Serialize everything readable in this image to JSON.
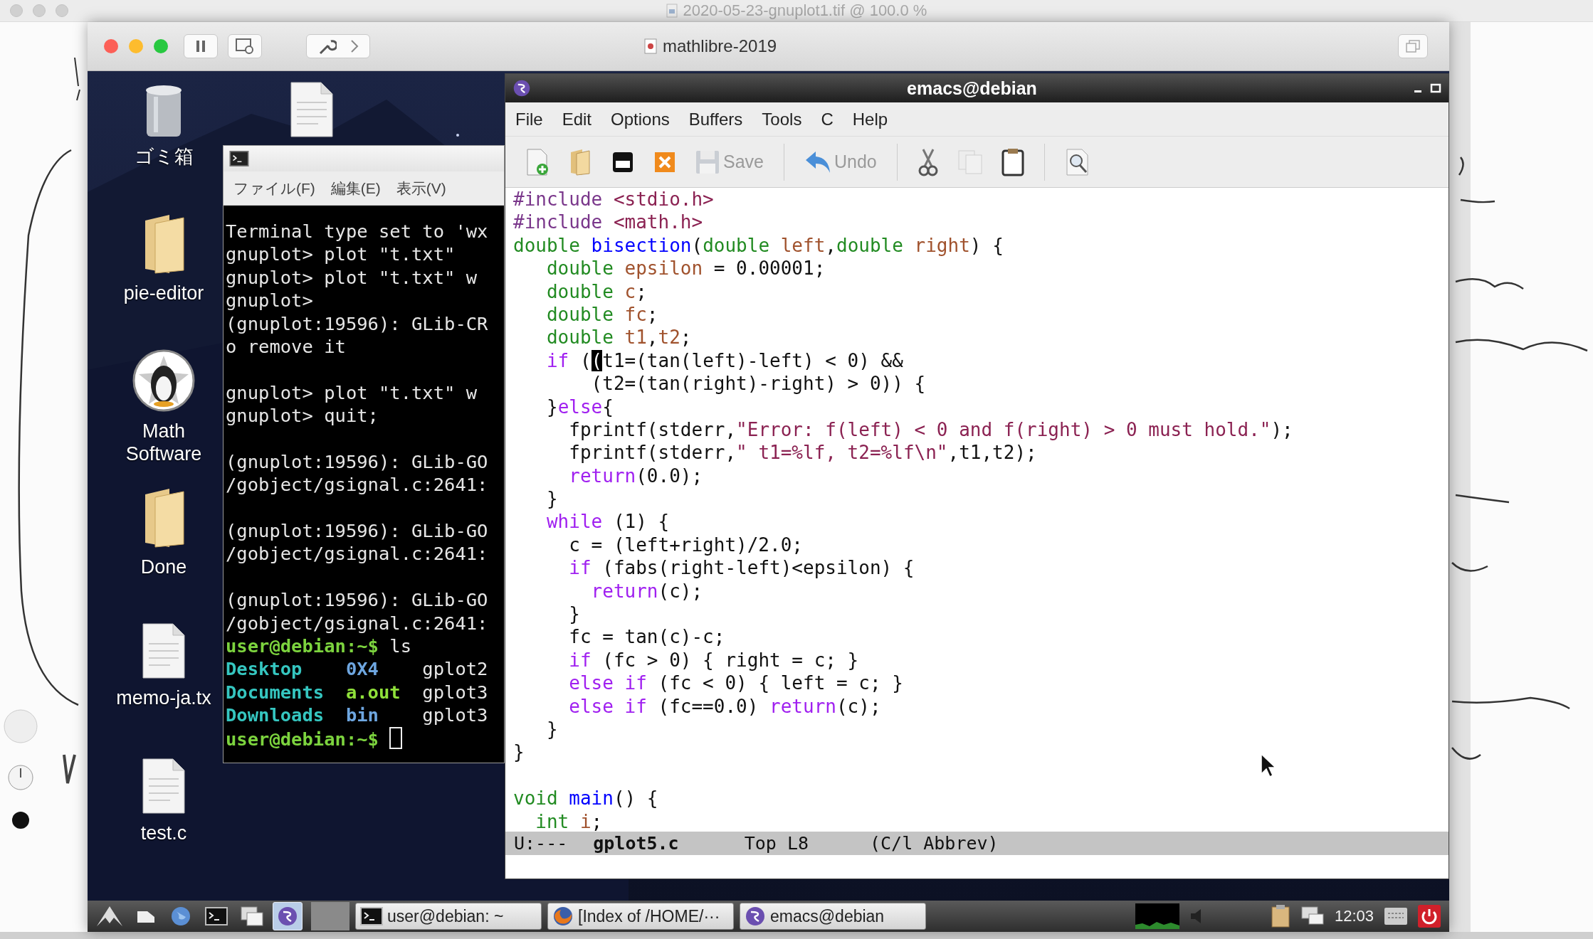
{
  "viewer": {
    "title": "2020-05-23-gnuplot1.tif @ 100.0 %"
  },
  "vm_window": {
    "title": "mathlibre-2019"
  },
  "desktop": {
    "icons": [
      {
        "kind": "trash",
        "label": "ゴミ箱"
      },
      {
        "kind": "file"
      },
      {
        "kind": "folder",
        "label": "pie-editor"
      },
      {
        "kind": "app",
        "label": "Math Software"
      },
      {
        "kind": "folder",
        "label": "Done"
      },
      {
        "kind": "file",
        "label": "memo-ja.tx"
      },
      {
        "kind": "file",
        "label": "test.c"
      }
    ]
  },
  "terminal": {
    "menu": [
      "ファイル(F)",
      "編集(E)",
      "表示(V)"
    ],
    "lines": [
      {
        "kind": "text",
        "spans": [
          {
            "kind": "plain",
            "text": "Terminal type set to 'wx"
          }
        ]
      },
      {
        "kind": "text",
        "spans": [
          {
            "kind": "plain",
            "text": "gnuplot> plot \"t.txt\""
          }
        ]
      },
      {
        "kind": "text",
        "spans": [
          {
            "kind": "plain",
            "text": "gnuplot> plot \"t.txt\" w"
          }
        ]
      },
      {
        "kind": "text",
        "spans": [
          {
            "kind": "plain",
            "text": "gnuplot>"
          }
        ]
      },
      {
        "kind": "text",
        "spans": [
          {
            "kind": "plain",
            "text": "(gnuplot:19596): GLib-CR"
          }
        ]
      },
      {
        "kind": "text",
        "spans": [
          {
            "kind": "plain",
            "text": "o remove it"
          }
        ]
      },
      {
        "kind": "blank"
      },
      {
        "kind": "text",
        "spans": [
          {
            "kind": "plain",
            "text": "gnuplot> plot \"t.txt\" w"
          }
        ]
      },
      {
        "kind": "text",
        "spans": [
          {
            "kind": "plain",
            "text": "gnuplot> quit;"
          }
        ]
      },
      {
        "kind": "blank"
      },
      {
        "kind": "text",
        "spans": [
          {
            "kind": "plain",
            "text": "(gnuplot:19596): GLib-GO"
          }
        ]
      },
      {
        "kind": "text",
        "spans": [
          {
            "kind": "plain",
            "text": "/gobject/gsignal.c:2641:"
          }
        ]
      },
      {
        "kind": "blank"
      },
      {
        "kind": "text",
        "spans": [
          {
            "kind": "plain",
            "text": "(gnuplot:19596): GLib-GO"
          }
        ]
      },
      {
        "kind": "text",
        "spans": [
          {
            "kind": "plain",
            "text": "/gobject/gsignal.c:2641:"
          }
        ]
      },
      {
        "kind": "blank"
      },
      {
        "kind": "text",
        "spans": [
          {
            "kind": "plain",
            "text": "(gnuplot:19596): GLib-GO"
          }
        ]
      },
      {
        "kind": "text",
        "spans": [
          {
            "kind": "plain",
            "text": "/gobject/gsignal.c:2641:"
          }
        ]
      },
      {
        "kind": "text",
        "spans": [
          {
            "kind": "prompt",
            "text": "user@debian:~$"
          },
          {
            "kind": "plain",
            "text": " ls"
          }
        ]
      },
      {
        "kind": "text",
        "spans": [
          {
            "kind": "dir",
            "text": "Desktop    "
          },
          {
            "kind": "special",
            "text": "0X4    "
          },
          {
            "kind": "plain",
            "text": "gplot2"
          }
        ]
      },
      {
        "kind": "text",
        "spans": [
          {
            "kind": "dir",
            "text": "Documents  "
          },
          {
            "kind": "exec",
            "text": "a.out  "
          },
          {
            "kind": "plain",
            "text": "gplot3"
          }
        ]
      },
      {
        "kind": "text",
        "spans": [
          {
            "kind": "dir",
            "text": "Downloads  "
          },
          {
            "kind": "special",
            "text": "bin    "
          },
          {
            "kind": "plain",
            "text": "gplot3"
          }
        ]
      },
      {
        "kind": "text",
        "spans": [
          {
            "kind": "prompt",
            "text": "user@debian:~$ "
          },
          {
            "kind": "cursor"
          }
        ]
      }
    ]
  },
  "emacs": {
    "title": "emacs@debian",
    "menu": [
      "File",
      "Edit",
      "Options",
      "Buffers",
      "Tools",
      "C",
      "Help"
    ],
    "toolbar": [
      {
        "kind": "new",
        "disabled": false
      },
      {
        "kind": "open",
        "disabled": false
      },
      {
        "kind": "close",
        "disabled": false
      },
      {
        "kind": "cancel",
        "disabled": false
      },
      {
        "kind": "save",
        "label": "Save",
        "disabled": true
      },
      {
        "kind": "separator"
      },
      {
        "kind": "undo",
        "label": "Undo",
        "disabled": false
      },
      {
        "kind": "separator"
      },
      {
        "kind": "cut",
        "disabled": false
      },
      {
        "kind": "copy",
        "disabled": true
      },
      {
        "kind": "paste",
        "disabled": false
      },
      {
        "kind": "separator"
      },
      {
        "kind": "search",
        "disabled": false
      }
    ],
    "code": [
      {
        "kind": "code",
        "spans": [
          {
            "kind": "pre",
            "text": "#include "
          },
          {
            "kind": "str",
            "text": "<stdio.h>"
          }
        ]
      },
      {
        "kind": "code",
        "spans": [
          {
            "kind": "pre",
            "text": "#include "
          },
          {
            "kind": "str",
            "text": "<math.h>"
          }
        ]
      },
      {
        "kind": "code",
        "spans": [
          {
            "kind": "type",
            "text": "double "
          },
          {
            "kind": "func",
            "text": "bisection"
          },
          {
            "kind": "plain",
            "text": "("
          },
          {
            "kind": "type",
            "text": "double "
          },
          {
            "kind": "var",
            "text": "left"
          },
          {
            "kind": "plain",
            "text": ","
          },
          {
            "kind": "type",
            "text": "double "
          },
          {
            "kind": "var",
            "text": "right"
          },
          {
            "kind": "plain",
            "text": ") {"
          }
        ]
      },
      {
        "kind": "code",
        "spans": [
          {
            "kind": "type",
            "text": "   double "
          },
          {
            "kind": "var",
            "text": "epsilon"
          },
          {
            "kind": "plain",
            "text": " = 0.00001;"
          }
        ]
      },
      {
        "kind": "code",
        "spans": [
          {
            "kind": "type",
            "text": "   double "
          },
          {
            "kind": "var",
            "text": "c"
          },
          {
            "kind": "plain",
            "text": ";"
          }
        ]
      },
      {
        "kind": "code",
        "spans": [
          {
            "kind": "type",
            "text": "   double "
          },
          {
            "kind": "var",
            "text": "fc"
          },
          {
            "kind": "plain",
            "text": ";"
          }
        ]
      },
      {
        "kind": "code",
        "spans": [
          {
            "kind": "type",
            "text": "   double "
          },
          {
            "kind": "var",
            "text": "t1"
          },
          {
            "kind": "plain",
            "text": ","
          },
          {
            "kind": "var",
            "text": "t2"
          },
          {
            "kind": "plain",
            "text": ";"
          }
        ]
      },
      {
        "kind": "code",
        "spans": [
          {
            "kind": "kw",
            "text": "   if"
          },
          {
            "kind": "plain",
            "text": " ("
          },
          {
            "kind": "cursor",
            "text": "("
          },
          {
            "kind": "plain",
            "text": "t1=(tan(left)-left) < 0) &&"
          }
        ]
      },
      {
        "kind": "code",
        "spans": [
          {
            "kind": "plain",
            "text": "       (t2=(tan(right)-right) > 0)) {"
          }
        ]
      },
      {
        "kind": "code",
        "spans": [
          {
            "kind": "plain",
            "text": "   }"
          },
          {
            "kind": "kw",
            "text": "else"
          },
          {
            "kind": "plain",
            "text": "{"
          }
        ]
      },
      {
        "kind": "code",
        "spans": [
          {
            "kind": "plain",
            "text": "     fprintf(stderr,"
          },
          {
            "kind": "str",
            "text": "\"Error: f(left) < 0 and f(right) > 0 must hold.\""
          },
          {
            "kind": "plain",
            "text": ");"
          }
        ]
      },
      {
        "kind": "code",
        "spans": [
          {
            "kind": "plain",
            "text": "     fprintf(stderr,"
          },
          {
            "kind": "str",
            "text": "\" t1=%lf, t2=%lf\\n\""
          },
          {
            "kind": "plain",
            "text": ",t1,t2);"
          }
        ]
      },
      {
        "kind": "code",
        "spans": [
          {
            "kind": "kw",
            "text": "     return"
          },
          {
            "kind": "plain",
            "text": "(0.0);"
          }
        ]
      },
      {
        "kind": "code",
        "spans": [
          {
            "kind": "plain",
            "text": "   }"
          }
        ]
      },
      {
        "kind": "code",
        "spans": [
          {
            "kind": "kw",
            "text": "   while"
          },
          {
            "kind": "plain",
            "text": " (1) {"
          }
        ]
      },
      {
        "kind": "code",
        "spans": [
          {
            "kind": "plain",
            "text": "     c = (left+right)/2.0;"
          }
        ]
      },
      {
        "kind": "code",
        "spans": [
          {
            "kind": "kw",
            "text": "     if"
          },
          {
            "kind": "plain",
            "text": " (fabs(right-left)<epsilon) {"
          }
        ]
      },
      {
        "kind": "code",
        "spans": [
          {
            "kind": "kw",
            "text": "       return"
          },
          {
            "kind": "plain",
            "text": "(c);"
          }
        ]
      },
      {
        "kind": "code",
        "spans": [
          {
            "kind": "plain",
            "text": "     }"
          }
        ]
      },
      {
        "kind": "code",
        "spans": [
          {
            "kind": "plain",
            "text": "     fc = tan(c)-c;"
          }
        ]
      },
      {
        "kind": "code",
        "spans": [
          {
            "kind": "kw",
            "text": "     if"
          },
          {
            "kind": "plain",
            "text": " (fc > 0) { right = c; }"
          }
        ]
      },
      {
        "kind": "code",
        "spans": [
          {
            "kind": "kw",
            "text": "     else if"
          },
          {
            "kind": "plain",
            "text": " (fc < 0) { left = c; }"
          }
        ]
      },
      {
        "kind": "code",
        "spans": [
          {
            "kind": "kw",
            "text": "     else if"
          },
          {
            "kind": "plain",
            "text": " (fc==0.0) "
          },
          {
            "kind": "kw",
            "text": "return"
          },
          {
            "kind": "plain",
            "text": "(c);"
          }
        ]
      },
      {
        "kind": "code",
        "spans": [
          {
            "kind": "plain",
            "text": "   }"
          }
        ]
      },
      {
        "kind": "code",
        "spans": [
          {
            "kind": "plain",
            "text": "}"
          }
        ]
      },
      {
        "kind": "blank"
      },
      {
        "kind": "code",
        "spans": [
          {
            "kind": "type",
            "text": "void "
          },
          {
            "kind": "func",
            "text": "main"
          },
          {
            "kind": "plain",
            "text": "() {"
          }
        ]
      },
      {
        "kind": "code",
        "spans": [
          {
            "kind": "type",
            "text": "  int "
          },
          {
            "kind": "var",
            "text": "i"
          },
          {
            "kind": "plain",
            "text": ";"
          }
        ]
      }
    ],
    "mode_line": {
      "state": "U:---",
      "buffer": "gplot5.c",
      "position": "Top L8",
      "modes": "(C/l Abbrev)"
    }
  },
  "taskbar": {
    "launchers": [
      {
        "kind": "start",
        "selected": false
      },
      {
        "kind": "files",
        "selected": false
      },
      {
        "kind": "globe",
        "selected": false
      },
      {
        "kind": "terminal",
        "selected": false
      },
      {
        "kind": "windows",
        "selected": false
      },
      {
        "kind": "emacs",
        "selected": true
      }
    ],
    "tasks": [
      {
        "kind": "terminal",
        "label": "user@debian: ~"
      },
      {
        "kind": "browser",
        "label": "[Index of /HOME/···"
      },
      {
        "kind": "emacs",
        "label": "emacs@debian"
      }
    ],
    "clock": "12:03"
  }
}
